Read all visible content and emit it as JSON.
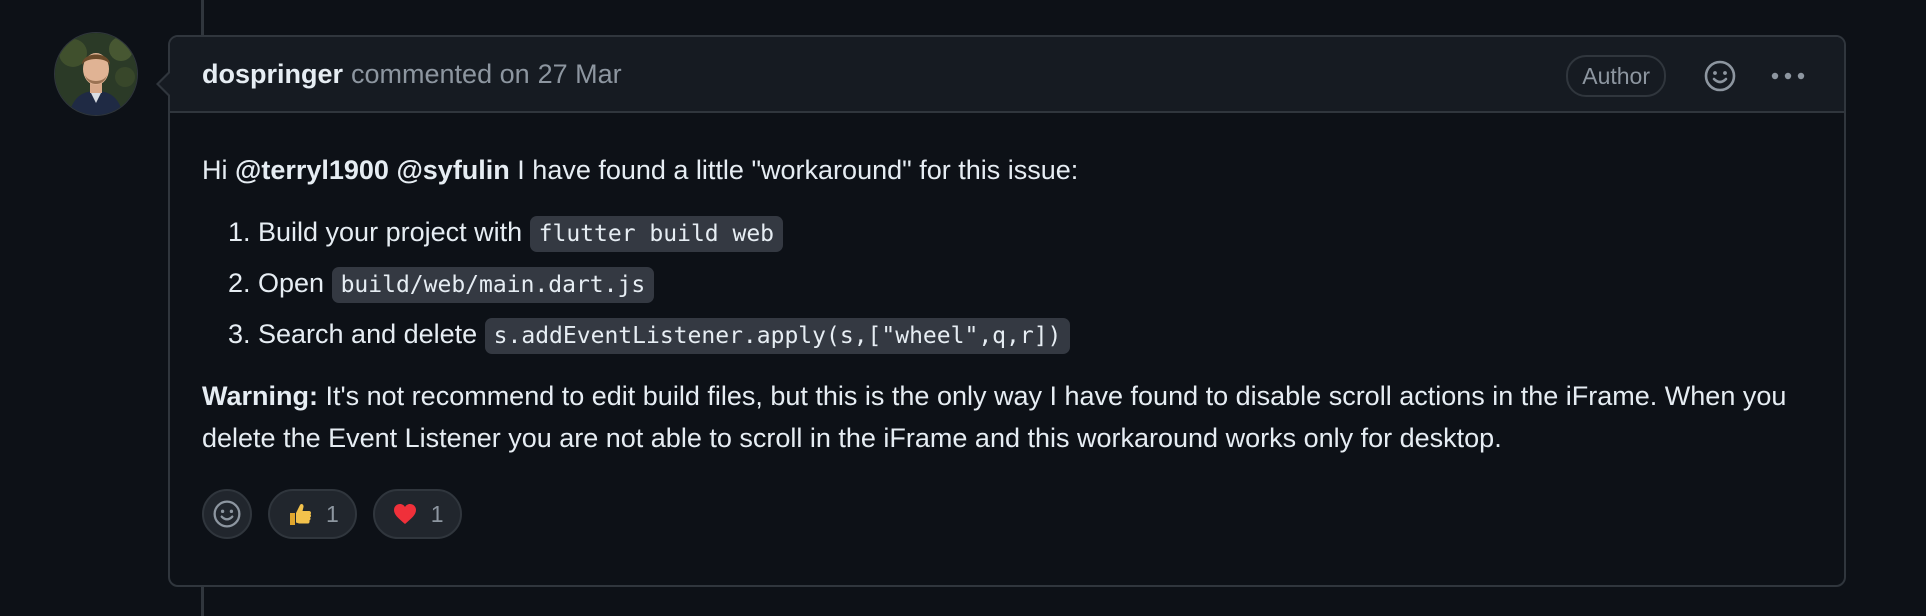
{
  "comment": {
    "author": "dospringer",
    "action_text": "commented on",
    "date": "27 Mar",
    "badge": "Author",
    "body": {
      "intro_prefix": "Hi ",
      "mention_1": "@terryl1900",
      "mention_2": "@syfulin",
      "intro_suffix": " I have found a little \"workaround\" for this issue:",
      "steps": [
        {
          "text": "Build your project with ",
          "code": "flutter build web"
        },
        {
          "text": "Open ",
          "code": "build/web/main.dart.js"
        },
        {
          "text": "Search and delete ",
          "code": "s.addEventListener.apply(s,[\"wheel\",q,r])"
        }
      ],
      "warning_label": "Warning:",
      "warning_text": " It's not recommend to edit build files, but this is the only way I have found to disable scroll actions in the iFrame. When you delete the Event Listener you are not able to scroll in the iFrame and this workaround works only for desktop."
    },
    "reactions": [
      {
        "emoji": "thumbs-up",
        "count": "1"
      },
      {
        "emoji": "heart",
        "count": "1"
      }
    ]
  },
  "colors": {
    "background": "#0d1117",
    "header_bg": "#161b22",
    "border": "#30363d",
    "muted_text": "#8d96a0",
    "code_bg": "#343942",
    "heart": "#f85149",
    "thumbs": "#f3c24c"
  }
}
